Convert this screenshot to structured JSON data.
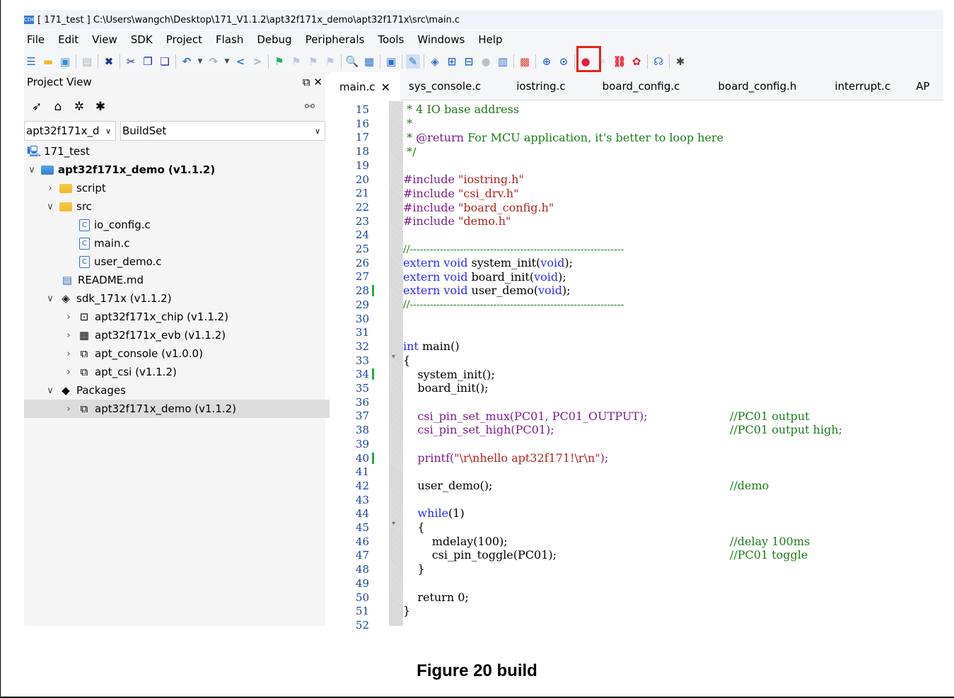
{
  "window": {
    "title": "[ 171_test ] C:\\Users\\wangch\\Desktop\\171_V1.1.2\\apt32f171x_demo\\apt32f171x\\src\\main.c",
    "app_icon_text": "CDK"
  },
  "menu": [
    "File",
    "Edit",
    "View",
    "SDK",
    "Project",
    "Flash",
    "Debug",
    "Peripherals",
    "Tools",
    "Windows",
    "Help"
  ],
  "project_view": {
    "title": "Project View",
    "target_select": "apt32f171x_d",
    "buildset_select": "BuildSet",
    "tree": [
      {
        "label": "171_test",
        "bold": false
      },
      {
        "label": "apt32f171x_demo (v1.1.2)",
        "bold": true
      },
      {
        "label": "script",
        "bold": false
      },
      {
        "label": "src",
        "bold": false
      },
      {
        "label": "io_config.c",
        "bold": false
      },
      {
        "label": "main.c",
        "bold": false
      },
      {
        "label": "user_demo.c",
        "bold": false
      },
      {
        "label": "README.md",
        "bold": false
      },
      {
        "label": "sdk_171x (v1.1.2)",
        "bold": false
      },
      {
        "label": "apt32f171x_chip (v1.1.2)",
        "bold": false
      },
      {
        "label": "apt32f171x_evb (v1.1.2)",
        "bold": false
      },
      {
        "label": "apt_console (v1.0.0)",
        "bold": false
      },
      {
        "label": "apt_csi (v1.1.2)",
        "bold": false
      },
      {
        "label": "Packages",
        "bold": false
      },
      {
        "label": "apt32f171x_demo (v1.1.2)",
        "bold": false
      }
    ]
  },
  "editor": {
    "tabs": [
      "main.c",
      "sys_console.c",
      "iostring.c",
      "board_config.c",
      "board_config.h",
      "interrupt.c",
      "AP"
    ],
    "line_numbers": [
      "15",
      "16",
      "17",
      "18",
      "19",
      "20",
      "21",
      "22",
      "23",
      "24",
      "25",
      "26",
      "27",
      "28",
      "29",
      "30",
      "31",
      "32",
      "33",
      "34",
      "35",
      "36",
      "37",
      "38",
      "39",
      "40",
      "41",
      "42",
      "43",
      "44",
      "45",
      "46",
      "47",
      "48",
      "49",
      "50",
      "51",
      "52"
    ],
    "code": {
      "l15": " * 4 IO base address",
      "l16": " *",
      "l17a": " * ",
      "l17b": "@return",
      "l17c": " For MCU application, it's better to loop here",
      "l18": " */",
      "l20a": "#include ",
      "l20b": "\"iostring.h\"",
      "l21a": "#include ",
      "l21b": "\"csi_drv.h\"",
      "l22a": "#include ",
      "l22b": "\"board_config.h\"",
      "l23a": "#include ",
      "l23b": "\"demo.h\"",
      "l25": "//----------------------------------------------------------------",
      "l26a": "extern void",
      "l26b": " system_init(",
      "l26c": "void",
      "l26d": ");",
      "l27a": "extern void",
      "l27b": " board_init(",
      "l27c": "void",
      "l27d": ");",
      "l28a": "extern void",
      "l28b": " user_demo(",
      "l28c": "void",
      "l28d": ");",
      "l29": "//----------------------------------------------------------------",
      "l32a": "int",
      "l32b": " main()",
      "l33": "{",
      "l34": "    system_init();",
      "l35": "    board_init();",
      "l37a": "    csi_pin_set_mux(PC01, PC01_OUTPUT);",
      "l37b": "//PC01 output",
      "l38a": "    csi_pin_set_high(PC01);",
      "l38b": "//PC01 output high;",
      "l40a": "    printf(",
      "l40b": "\"\\r\\nhello apt32f171!\\r\\n\"",
      "l40c": ");",
      "l42a": "    user_demo();",
      "l42b": "//demo",
      "l44a": "    while",
      "l44b": "(1)",
      "l45": "    {",
      "l46a": "        mdelay(100);",
      "l46b": "//delay 100ms",
      "l47a": "        csi_pin_toggle(PC01);",
      "l47b": "//PC01 toggle",
      "l48": "    }",
      "l50": "    return 0;",
      "l51": "}"
    }
  },
  "caption": "Figure 20 build"
}
